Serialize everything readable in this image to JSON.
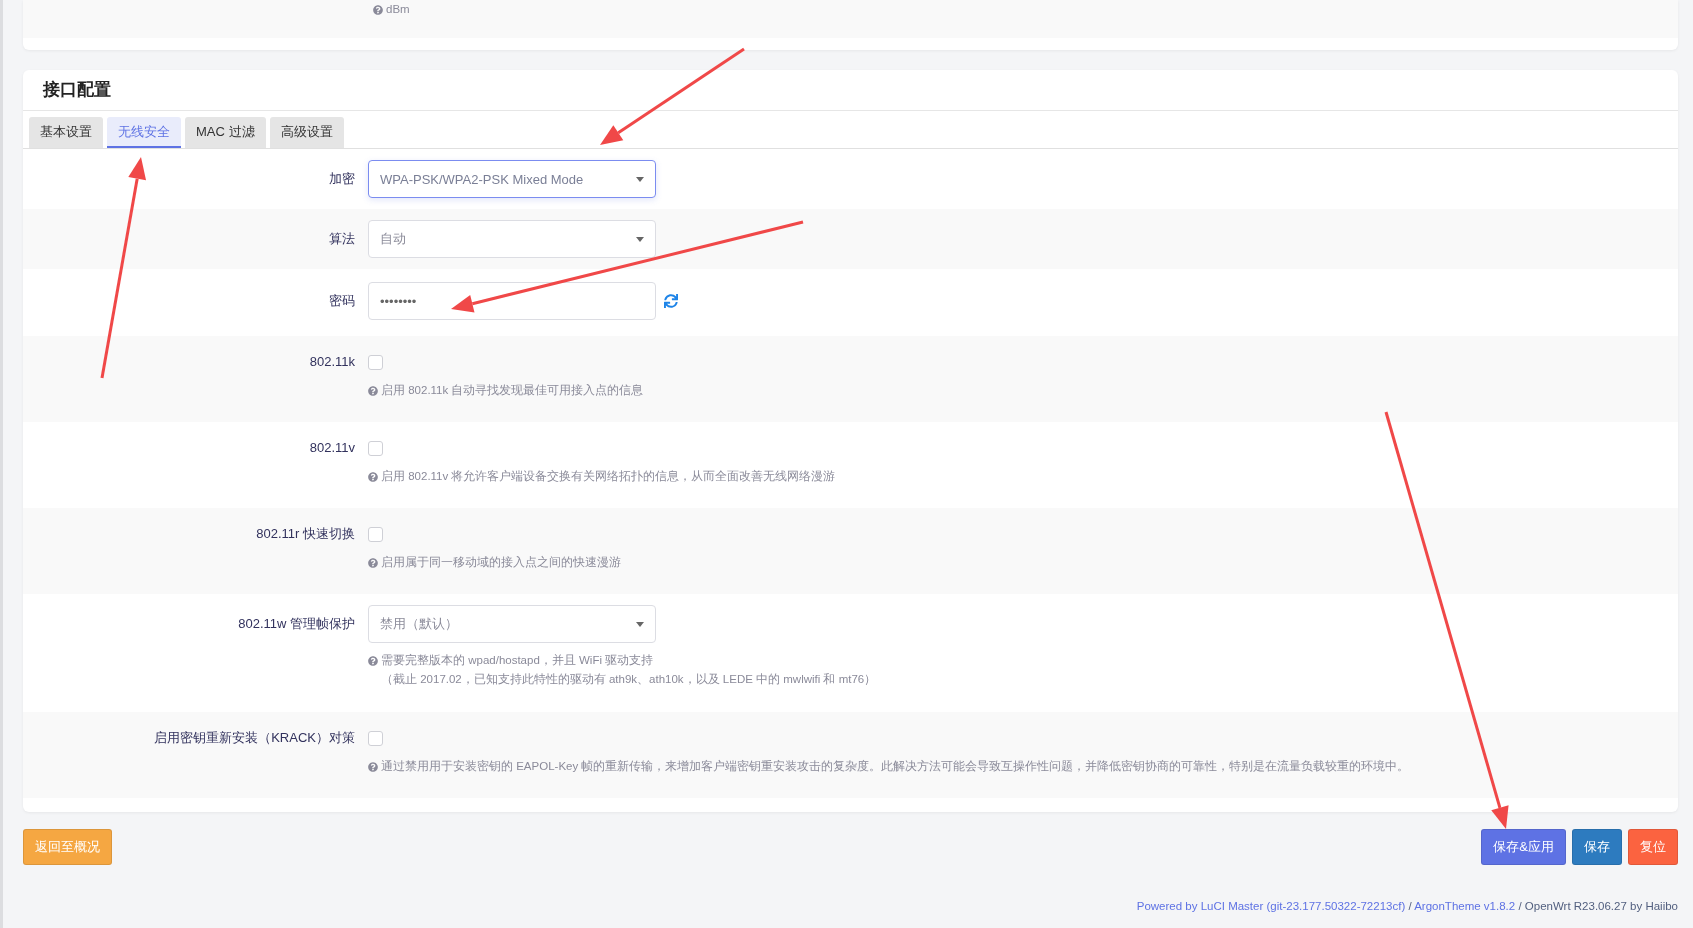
{
  "top_card": {
    "help": "dBm"
  },
  "section": {
    "title": "接口配置",
    "tabs": [
      {
        "label": "基本设置",
        "selected": false
      },
      {
        "label": "无线安全",
        "selected": true
      },
      {
        "label": "MAC 过滤",
        "selected": false
      },
      {
        "label": "高级设置",
        "selected": false
      }
    ],
    "fields": [
      {
        "kind": "select",
        "label": "加密",
        "value": "WPA-PSK/WPA2-PSK Mixed Mode",
        "focused": true
      },
      {
        "kind": "select",
        "label": "算法",
        "value": "自动",
        "focused": false
      },
      {
        "kind": "password",
        "label": "密码",
        "value": "••••••••"
      },
      {
        "kind": "checkbox",
        "label": "802.11k",
        "checked": false,
        "help": [
          "启用 802.11k 自动寻找发现最佳可用接入点的信息"
        ]
      },
      {
        "kind": "checkbox",
        "label": "802.11v",
        "checked": false,
        "help": [
          "启用 802.11v 将允许客户端设备交换有关网络拓扑的信息，从而全面改善无线网络漫游"
        ]
      },
      {
        "kind": "checkbox",
        "label": "802.11r 快速切换",
        "checked": false,
        "help": [
          "启用属于同一移动域的接入点之间的快速漫游"
        ]
      },
      {
        "kind": "select",
        "label": "802.11w 管理帧保护",
        "value": "禁用（默认）",
        "focused": false,
        "help": [
          "需要完整版本的 wpad/hostapd，并且 WiFi 驱动支持",
          "（截止 2017.02，已知支持此特性的驱动有 ath9k、ath10k，以及 LEDE 中的 mwlwifi 和 mt76）"
        ]
      },
      {
        "kind": "checkbox",
        "label": "启用密钥重新安装（KRACK）对策",
        "checked": false,
        "help": [
          "通过禁用用于安装密钥的 EAPOL-Key 帧的重新传输，来增加客户端密钥重安装攻击的复杂度。此解决方法可能会导致互操作性问题，并降低密钥协商的可靠性，特别是在流量负载较重的环境中。"
        ]
      }
    ]
  },
  "buttons_left": [
    {
      "label": "返回至概况",
      "kind": "warning"
    }
  ],
  "buttons_right": [
    {
      "label": "保存&应用",
      "kind": "apply"
    },
    {
      "label": "保存",
      "kind": "save"
    },
    {
      "label": "复位",
      "kind": "reset"
    }
  ],
  "footer": {
    "parts": [
      {
        "kind": "link",
        "text": "Powered by LuCI Master (git-23.177.50322-72213cf)"
      },
      {
        "kind": "text",
        "text": " / "
      },
      {
        "kind": "link",
        "text": "ArgonTheme v1.8.2"
      },
      {
        "kind": "text",
        "text": " / OpenWrt R23.06.27 by Haiibo"
      }
    ]
  }
}
